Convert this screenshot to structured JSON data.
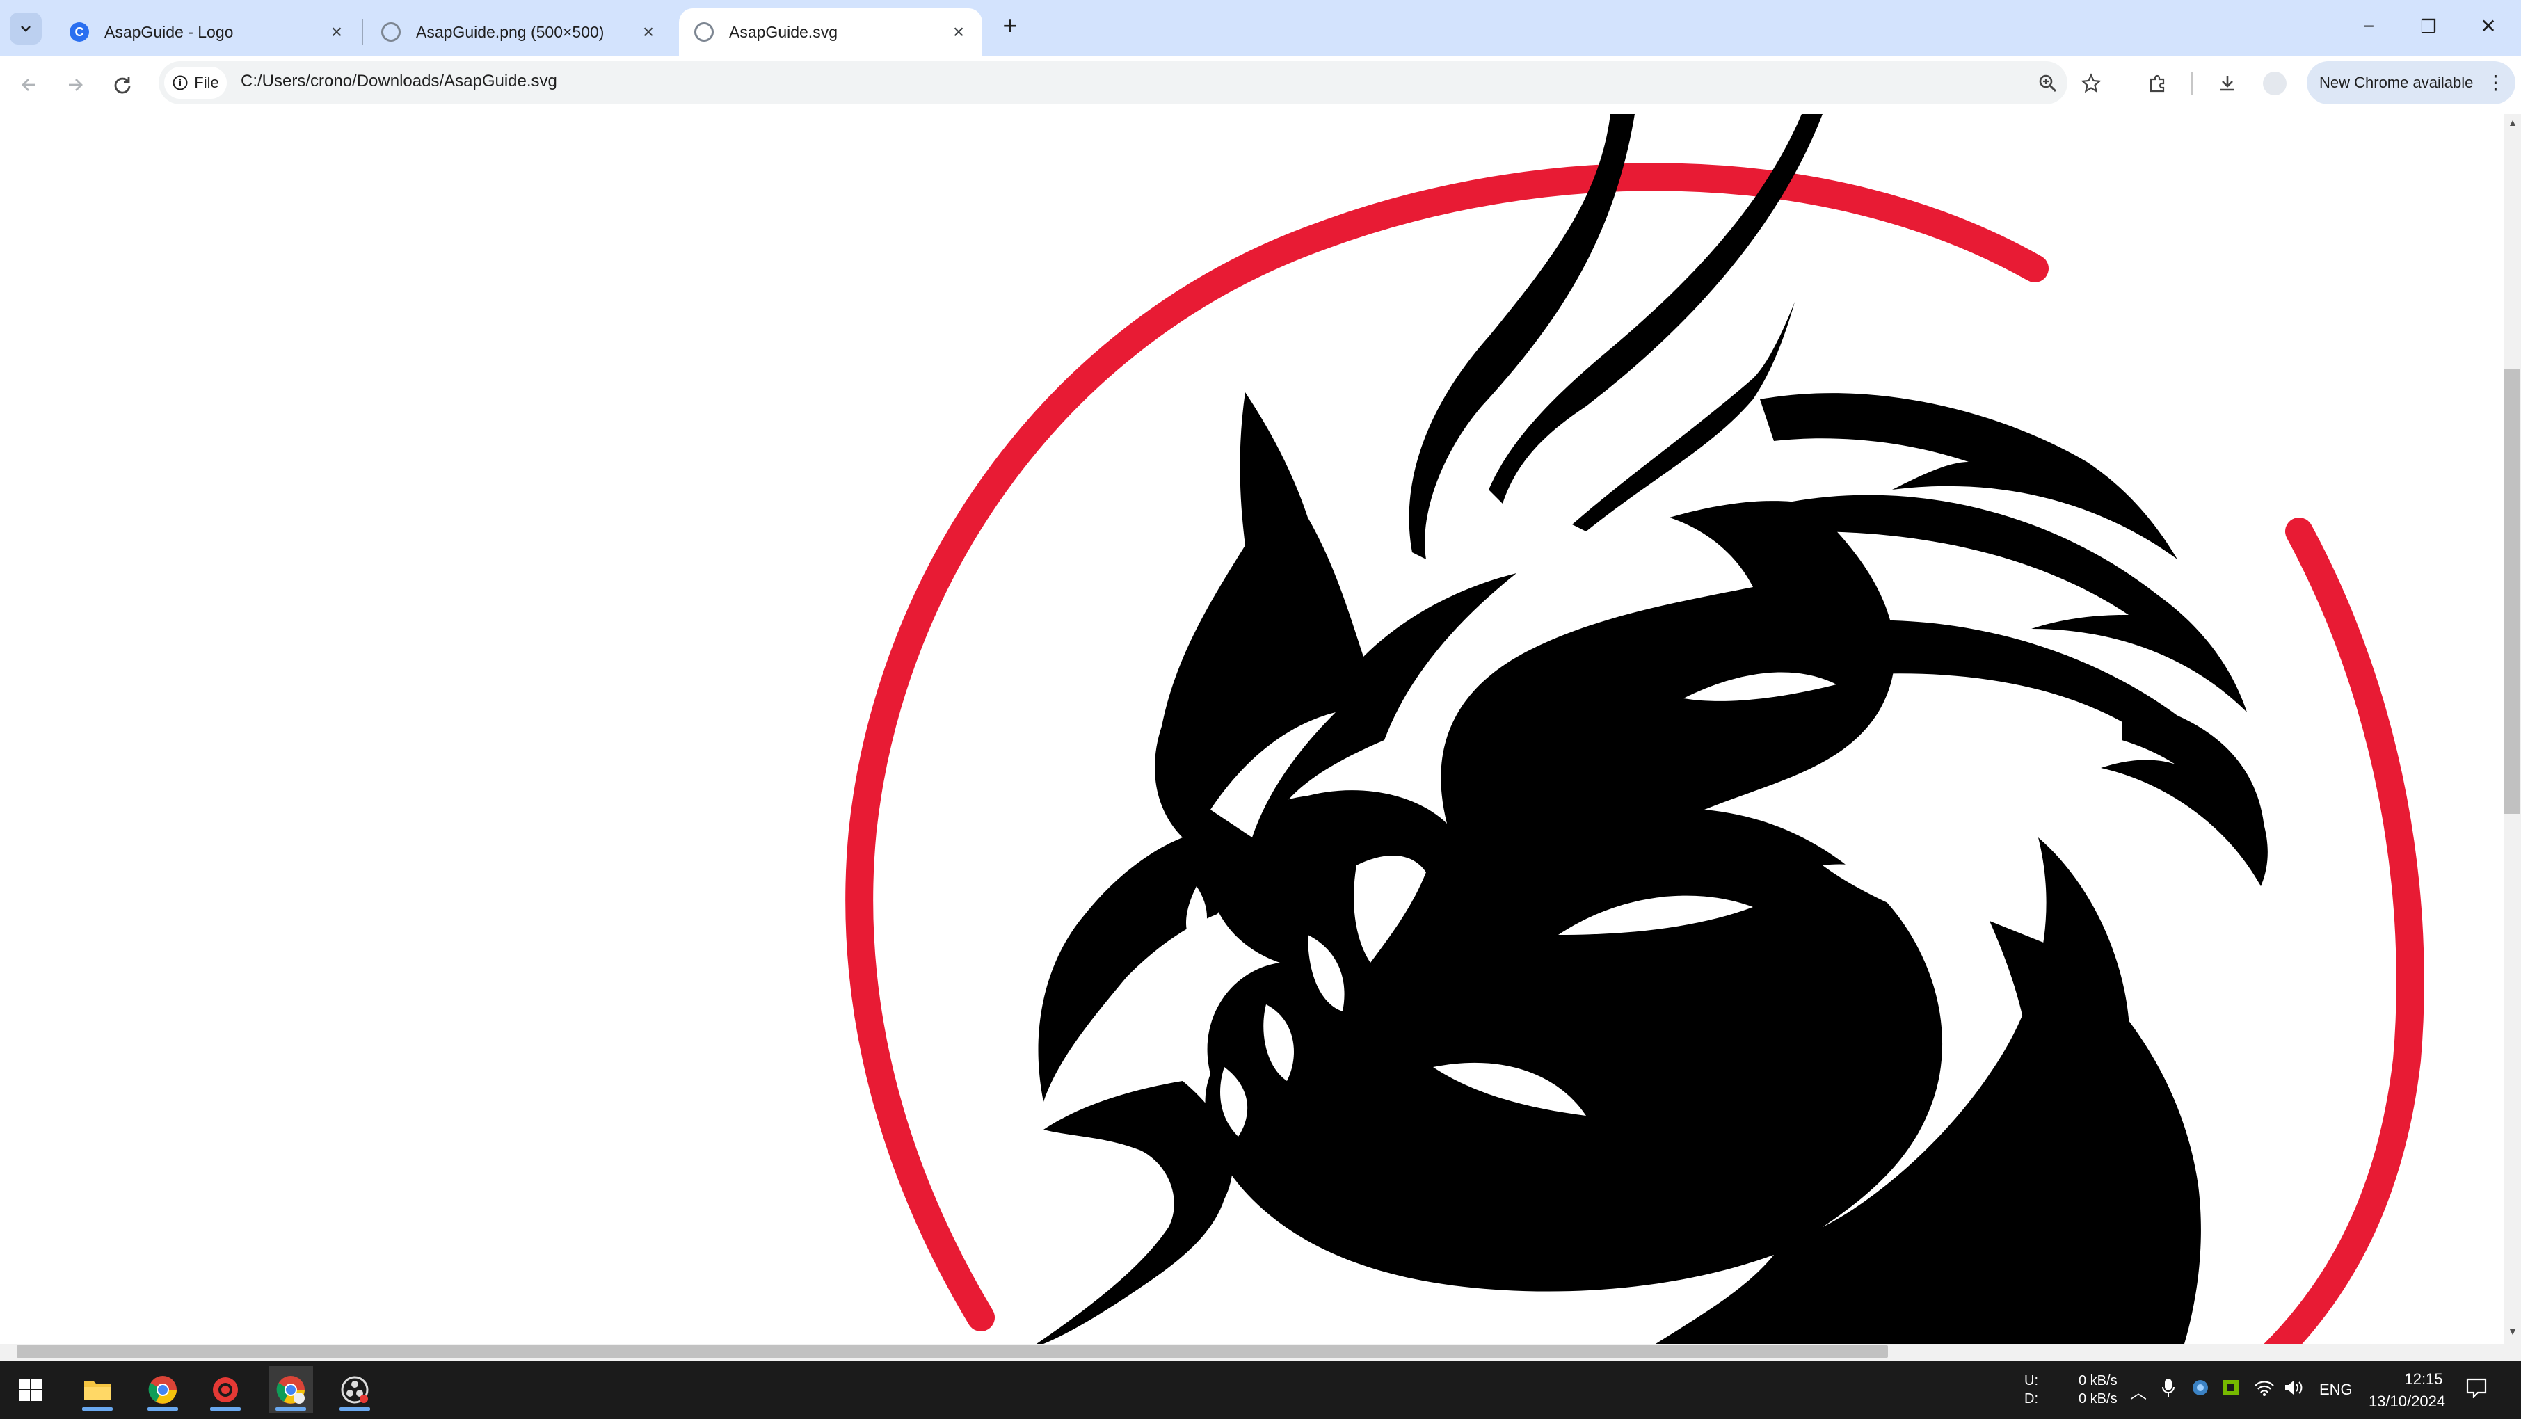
{
  "browser": {
    "tabs": [
      {
        "title": "AsapGuide - Logo",
        "active": false
      },
      {
        "title": "AsapGuide.png (500×500)",
        "active": false
      },
      {
        "title": "AsapGuide.svg",
        "active": true
      }
    ],
    "new_tab_label": "+",
    "window_controls": {
      "minimize": "−",
      "restore": "❐",
      "close": "✕"
    },
    "address": {
      "chip_label": "File",
      "url": "C:/Users/crono/Downloads/AsapGuide.svg"
    },
    "update_button_label": "New Chrome available"
  },
  "content": {
    "image_description_name": "dragon-logo",
    "colors": {
      "ring": "#e81b34",
      "dragon": "#000000",
      "background": "#ffffff"
    }
  },
  "taskbar": {
    "apps": [
      "start",
      "file-explorer",
      "chrome",
      "screen-recorder",
      "chrome-active",
      "obs"
    ],
    "network": {
      "up_label": "U:",
      "down_label": "D:",
      "up_value": "0 kB/s",
      "down_value": "0 kB/s"
    },
    "language": "ENG",
    "time": "12:15",
    "date": "13/10/2024"
  }
}
